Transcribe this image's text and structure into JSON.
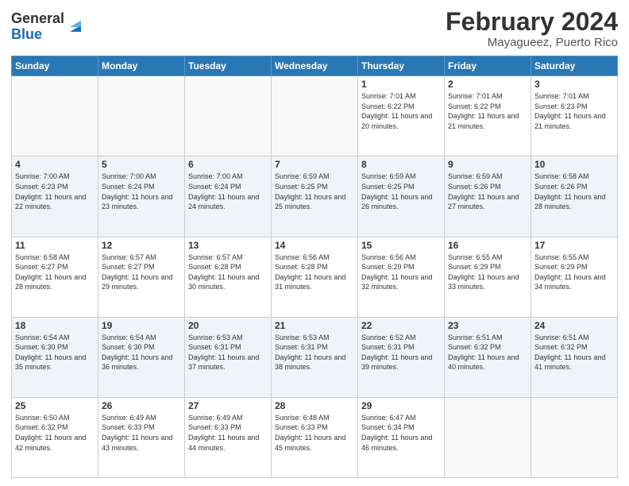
{
  "header": {
    "logo": {
      "general": "General",
      "blue": "Blue"
    },
    "title": "February 2024",
    "subtitle": "Mayagueez, Puerto Rico"
  },
  "calendar": {
    "days_of_week": [
      "Sunday",
      "Monday",
      "Tuesday",
      "Wednesday",
      "Thursday",
      "Friday",
      "Saturday"
    ],
    "weeks": [
      [
        {
          "day": "",
          "info": ""
        },
        {
          "day": "",
          "info": ""
        },
        {
          "day": "",
          "info": ""
        },
        {
          "day": "",
          "info": ""
        },
        {
          "day": "1",
          "info": "Sunrise: 7:01 AM\nSunset: 6:22 PM\nDaylight: 11 hours and 20 minutes."
        },
        {
          "day": "2",
          "info": "Sunrise: 7:01 AM\nSunset: 6:22 PM\nDaylight: 11 hours and 21 minutes."
        },
        {
          "day": "3",
          "info": "Sunrise: 7:01 AM\nSunset: 6:23 PM\nDaylight: 11 hours and 21 minutes."
        }
      ],
      [
        {
          "day": "4",
          "info": "Sunrise: 7:00 AM\nSunset: 6:23 PM\nDaylight: 11 hours and 22 minutes."
        },
        {
          "day": "5",
          "info": "Sunrise: 7:00 AM\nSunset: 6:24 PM\nDaylight: 11 hours and 23 minutes."
        },
        {
          "day": "6",
          "info": "Sunrise: 7:00 AM\nSunset: 6:24 PM\nDaylight: 11 hours and 24 minutes."
        },
        {
          "day": "7",
          "info": "Sunrise: 6:59 AM\nSunset: 6:25 PM\nDaylight: 11 hours and 25 minutes."
        },
        {
          "day": "8",
          "info": "Sunrise: 6:59 AM\nSunset: 6:25 PM\nDaylight: 11 hours and 26 minutes."
        },
        {
          "day": "9",
          "info": "Sunrise: 6:59 AM\nSunset: 6:26 PM\nDaylight: 11 hours and 27 minutes."
        },
        {
          "day": "10",
          "info": "Sunrise: 6:58 AM\nSunset: 6:26 PM\nDaylight: 11 hours and 28 minutes."
        }
      ],
      [
        {
          "day": "11",
          "info": "Sunrise: 6:58 AM\nSunset: 6:27 PM\nDaylight: 11 hours and 28 minutes."
        },
        {
          "day": "12",
          "info": "Sunrise: 6:57 AM\nSunset: 6:27 PM\nDaylight: 11 hours and 29 minutes."
        },
        {
          "day": "13",
          "info": "Sunrise: 6:57 AM\nSunset: 6:28 PM\nDaylight: 11 hours and 30 minutes."
        },
        {
          "day": "14",
          "info": "Sunrise: 6:56 AM\nSunset: 6:28 PM\nDaylight: 11 hours and 31 minutes."
        },
        {
          "day": "15",
          "info": "Sunrise: 6:56 AM\nSunset: 6:29 PM\nDaylight: 11 hours and 32 minutes."
        },
        {
          "day": "16",
          "info": "Sunrise: 6:55 AM\nSunset: 6:29 PM\nDaylight: 11 hours and 33 minutes."
        },
        {
          "day": "17",
          "info": "Sunrise: 6:55 AM\nSunset: 6:29 PM\nDaylight: 11 hours and 34 minutes."
        }
      ],
      [
        {
          "day": "18",
          "info": "Sunrise: 6:54 AM\nSunset: 6:30 PM\nDaylight: 11 hours and 35 minutes."
        },
        {
          "day": "19",
          "info": "Sunrise: 6:54 AM\nSunset: 6:30 PM\nDaylight: 11 hours and 36 minutes."
        },
        {
          "day": "20",
          "info": "Sunrise: 6:53 AM\nSunset: 6:31 PM\nDaylight: 11 hours and 37 minutes."
        },
        {
          "day": "21",
          "info": "Sunrise: 6:53 AM\nSunset: 6:31 PM\nDaylight: 11 hours and 38 minutes."
        },
        {
          "day": "22",
          "info": "Sunrise: 6:52 AM\nSunset: 6:31 PM\nDaylight: 11 hours and 39 minutes."
        },
        {
          "day": "23",
          "info": "Sunrise: 6:51 AM\nSunset: 6:32 PM\nDaylight: 11 hours and 40 minutes."
        },
        {
          "day": "24",
          "info": "Sunrise: 6:51 AM\nSunset: 6:32 PM\nDaylight: 11 hours and 41 minutes."
        }
      ],
      [
        {
          "day": "25",
          "info": "Sunrise: 6:50 AM\nSunset: 6:32 PM\nDaylight: 11 hours and 42 minutes."
        },
        {
          "day": "26",
          "info": "Sunrise: 6:49 AM\nSunset: 6:33 PM\nDaylight: 11 hours and 43 minutes."
        },
        {
          "day": "27",
          "info": "Sunrise: 6:49 AM\nSunset: 6:33 PM\nDaylight: 11 hours and 44 minutes."
        },
        {
          "day": "28",
          "info": "Sunrise: 6:48 AM\nSunset: 6:33 PM\nDaylight: 11 hours and 45 minutes."
        },
        {
          "day": "29",
          "info": "Sunrise: 6:47 AM\nSunset: 6:34 PM\nDaylight: 11 hours and 46 minutes."
        },
        {
          "day": "",
          "info": ""
        },
        {
          "day": "",
          "info": ""
        }
      ]
    ]
  }
}
